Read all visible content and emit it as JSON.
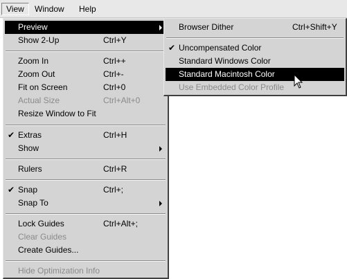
{
  "menubar": {
    "items": [
      {
        "label": "View"
      },
      {
        "label": "Window"
      },
      {
        "label": "Help"
      }
    ]
  },
  "view_menu": {
    "items": [
      {
        "label": "Preview",
        "shortcut": "",
        "checked": false,
        "submenu": true,
        "disabled": false,
        "highlighted": true
      },
      {
        "label": "Show 2-Up",
        "shortcut": "Ctrl+Y"
      },
      {
        "label": "Zoom In",
        "shortcut": "Ctrl++"
      },
      {
        "label": "Zoom Out",
        "shortcut": "Ctrl+-"
      },
      {
        "label": "Fit on Screen",
        "shortcut": "Ctrl+0"
      },
      {
        "label": "Actual Size",
        "shortcut": "Ctrl+Alt+0",
        "disabled": true
      },
      {
        "label": "Resize Window to Fit",
        "shortcut": ""
      },
      {
        "label": "Extras",
        "shortcut": "Ctrl+H",
        "checked": true
      },
      {
        "label": "Show",
        "shortcut": "",
        "submenu": true
      },
      {
        "label": "Rulers",
        "shortcut": "Ctrl+R"
      },
      {
        "label": "Snap",
        "shortcut": "Ctrl+;",
        "checked": true
      },
      {
        "label": "Snap To",
        "shortcut": "",
        "submenu": true
      },
      {
        "label": "Lock Guides",
        "shortcut": "Ctrl+Alt+;"
      },
      {
        "label": "Clear Guides",
        "shortcut": "",
        "disabled": true
      },
      {
        "label": "Create Guides...",
        "shortcut": ""
      },
      {
        "label": "Hide Optimization Info",
        "shortcut": "",
        "disabled": true
      }
    ]
  },
  "preview_submenu": {
    "items": [
      {
        "label": "Browser Dither",
        "shortcut": "Ctrl+Shift+Y"
      },
      {
        "label": "Uncompensated Color",
        "shortcut": "",
        "checked": true
      },
      {
        "label": "Standard Windows Color",
        "shortcut": ""
      },
      {
        "label": "Standard Macintosh Color",
        "shortcut": "",
        "highlighted": true
      },
      {
        "label": "Use Embedded Color Profile",
        "shortcut": "",
        "disabled": true
      }
    ]
  },
  "check_glyph": "✔",
  "colors": {
    "highlight": "#000000",
    "menu_bg": "#d4d4d4",
    "disabled_text": "#8a8a8a"
  }
}
